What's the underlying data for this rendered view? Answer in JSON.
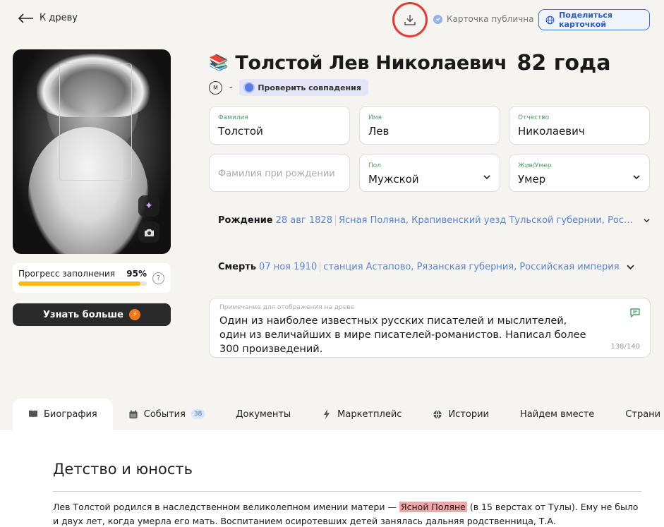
{
  "topbar": {
    "back_label": "К древу",
    "public_label": "Карточка публична",
    "share_label": "Поделиться карточкой"
  },
  "person": {
    "emoji": "📚",
    "full_name": "Толстой Лев Николаевич",
    "age": "82 года",
    "gender_symbol": "М",
    "gender_dash": "-",
    "match_label": "Проверить совпадения"
  },
  "progress": {
    "label": "Прогресс заполнения",
    "percent_text": "95%",
    "percent": 95,
    "help": "?"
  },
  "learn_more": {
    "label": "Узнать больше",
    "coin": "⚡"
  },
  "fields": {
    "surname": {
      "label": "Фамилия",
      "value": "Толстой"
    },
    "name": {
      "label": "Имя",
      "value": "Лев"
    },
    "patronymic": {
      "label": "Отчество",
      "value": "Николаевич"
    },
    "birth_surname": {
      "placeholder": "Фамилия при рождении"
    },
    "sex": {
      "label": "Пол",
      "value": "Мужской"
    },
    "alive": {
      "label": "Жив/Умер",
      "value": "Умер"
    }
  },
  "birth": {
    "label": "Рождение",
    "date": "28 авг 1828",
    "place": "Ясная Поляна, Крапивенский уезд Тульской губернии, Российская империя"
  },
  "death": {
    "label": "Смерть",
    "date": "07 ноя 1910",
    "place": "станция Астапово, Рязанская губерния, Российская империя"
  },
  "note": {
    "label": "Примечание для отображения на древе",
    "text": "Один из наиболее известных русских писателей и мыслителей, один из величайших в мире писателей-романистов. Написал более 300 произведений.",
    "counter": "138/140"
  },
  "tabs": [
    {
      "label": "Биография",
      "icon": "book-icon"
    },
    {
      "label": "События",
      "icon": "calendar-icon",
      "badge": "38"
    },
    {
      "label": "Документы"
    },
    {
      "label": "Маркетплейс",
      "icon": "lightning-icon"
    },
    {
      "label": "Истории",
      "icon": "globe-icon"
    },
    {
      "label": "Найдем вместе"
    },
    {
      "label": "Страни"
    }
  ],
  "biography": {
    "heading": "Детство и юность",
    "text_before": "Лев Толстой родился в наследственном великолепном имении матери — ",
    "highlight": "Ясной Поляне",
    "text_after": " (в 15 верстах от Тулы). Ему не было и двух лет, когда умерла его мать. Воспитанием осиротевших детей занялась дальняя родственница, Т.А."
  },
  "colors": {
    "accent_blue": "#3d6fd6",
    "highlight_red": "#e53935",
    "progress_yellow": "#f3bf0c",
    "label_green": "#4c9e66"
  }
}
